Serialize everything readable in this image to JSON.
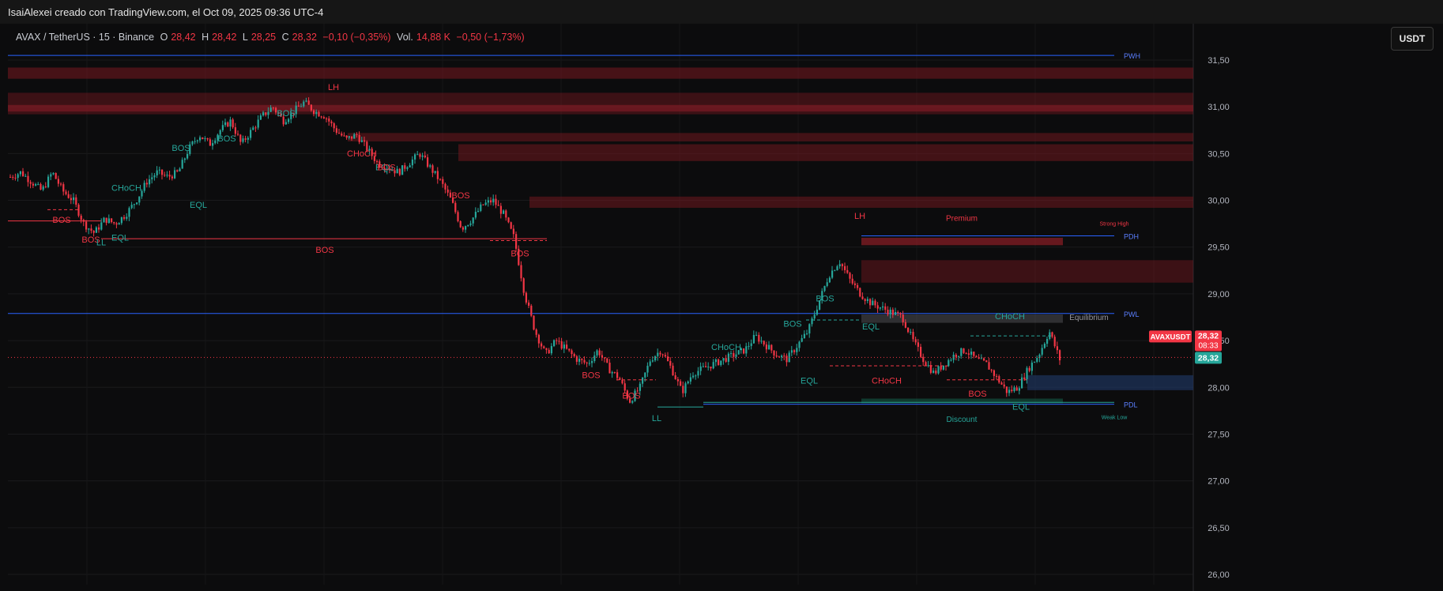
{
  "header": {
    "attribution": "IsaiAlexei creado con TradingView.com, el Oct 09, 2025 09:36 UTC-4"
  },
  "legend": {
    "symbol": "AVAX / TetherUS · 15 · Binance",
    "open_label": "O",
    "open": "28,42",
    "high_label": "H",
    "high": "28,42",
    "low_label": "L",
    "low": "28,25",
    "close_label": "C",
    "close": "28,32",
    "change": "−0,10 (−0,35%)",
    "vol_label": "Vol.",
    "vol": "14,88 K",
    "vol_change": "−0,50 (−1,73%)"
  },
  "currency_button": "USDT",
  "colors": {
    "up": "#26a69a",
    "down": "#f23645",
    "level": "#2962ff",
    "bg": "#0c0c0d"
  },
  "chart_data": {
    "type": "candlestick",
    "title": "",
    "ylim": [
      25.8,
      31.6
    ],
    "y_ticks": [
      "31,50",
      "31,00",
      "30,50",
      "30,00",
      "29,50",
      "29,00",
      "28,50",
      "28,00",
      "27,50",
      "27,00",
      "26,50",
      "26,00"
    ],
    "y_tick_values": [
      31.5,
      31.0,
      30.5,
      30.0,
      29.5,
      29.0,
      28.5,
      28.0,
      27.5,
      27.0,
      26.5,
      26.0
    ],
    "last_price": 28.32,
    "price_tags": {
      "symbol": "AVAXUSDT",
      "price": "28,32",
      "countdown": "08:33",
      "current": "28,32"
    },
    "levels": [
      {
        "label": "PWH",
        "value": 31.55
      },
      {
        "label": "PDH",
        "value": 29.62
      },
      {
        "label": "PWL",
        "value": 28.79
      },
      {
        "label": "PDL",
        "value": 27.82
      }
    ],
    "zones_text": {
      "premium": "Premium",
      "equilibrium": "Equilibrium",
      "discount": "Discount",
      "strong_high": "Strong High",
      "weak_low": "Weak Low"
    },
    "anchors": [
      30.25,
      30.3,
      30.2,
      30.1,
      30.3,
      30.1,
      30.0,
      29.75,
      29.65,
      29.8,
      29.75,
      29.85,
      30.0,
      30.2,
      30.3,
      30.25,
      30.3,
      30.55,
      30.7,
      30.6,
      30.75,
      30.85,
      30.6,
      30.75,
      30.9,
      31.0,
      30.85,
      30.95,
      31.05,
      30.95,
      30.9,
      30.75,
      30.65,
      30.7,
      30.55,
      30.4,
      30.35,
      30.3,
      30.4,
      30.5,
      30.35,
      30.2,
      30.0,
      29.7,
      29.8,
      29.95,
      30.0,
      29.85,
      29.6,
      29.0,
      28.6,
      28.35,
      28.5,
      28.4,
      28.3,
      28.25,
      28.4,
      28.2,
      28.1,
      27.85,
      28.0,
      28.3,
      28.4,
      28.2,
      27.95,
      28.15,
      28.2,
      28.25,
      28.3,
      28.35,
      28.4,
      28.55,
      28.45,
      28.35,
      28.3,
      28.45,
      28.6,
      28.9,
      29.2,
      29.35,
      29.15,
      29.0,
      28.9,
      28.85,
      28.8,
      28.75,
      28.5,
      28.3,
      28.15,
      28.25,
      28.35,
      28.4,
      28.3,
      28.25,
      28.1,
      27.95,
      28.0,
      28.2,
      28.35,
      28.6,
      28.3
    ]
  },
  "annotations": [
    {
      "t": "LH",
      "price": 31.18,
      "x": 422,
      "c": "down"
    },
    {
      "t": "BOS",
      "price": 30.9,
      "x": 362,
      "c": "up"
    },
    {
      "t": "BOS",
      "price": 30.63,
      "x": 287,
      "c": "up"
    },
    {
      "t": "BOS",
      "price": 30.53,
      "x": 229,
      "c": "up"
    },
    {
      "t": "CHoCH",
      "price": 30.47,
      "x": 458,
      "c": "down"
    },
    {
      "t": "EQL",
      "price": 30.32,
      "x": 486,
      "c": "up"
    },
    {
      "t": "BOS",
      "price": 30.32,
      "x": 489,
      "c": "down"
    },
    {
      "t": "CHoCH",
      "price": 30.1,
      "x": 160,
      "c": "up"
    },
    {
      "t": "EQL",
      "price": 29.92,
      "x": 251,
      "c": "up"
    },
    {
      "t": "BOS",
      "price": 30.02,
      "x": 583,
      "c": "down"
    },
    {
      "t": "BOS",
      "price": 29.76,
      "x": 78,
      "c": "down"
    },
    {
      "t": "BOS",
      "price": 29.55,
      "x": 115,
      "c": "down"
    },
    {
      "t": "LL",
      "price": 29.52,
      "x": 128,
      "c": "up"
    },
    {
      "t": "EQL",
      "price": 29.57,
      "x": 152,
      "c": "up"
    },
    {
      "t": "BOS",
      "price": 29.44,
      "x": 411,
      "c": "down"
    },
    {
      "t": "BOS",
      "price": 29.4,
      "x": 658,
      "c": "down"
    },
    {
      "t": "LH",
      "price": 29.8,
      "x": 1088,
      "c": "down"
    },
    {
      "t": "BOS",
      "price": 28.92,
      "x": 1044,
      "c": "up"
    },
    {
      "t": "EQL",
      "price": 28.62,
      "x": 1102,
      "c": "up"
    },
    {
      "t": "BOS",
      "price": 28.65,
      "x": 1003,
      "c": "up"
    },
    {
      "t": "CHoCH",
      "price": 28.73,
      "x": 1278,
      "c": "up"
    },
    {
      "t": "CHoCH",
      "price": 28.4,
      "x": 919,
      "c": "up"
    },
    {
      "t": "BOS",
      "price": 28.1,
      "x": 748,
      "c": "down"
    },
    {
      "t": "EQL",
      "price": 28.04,
      "x": 1024,
      "c": "up"
    },
    {
      "t": "CHoCH",
      "price": 28.04,
      "x": 1122,
      "c": "down"
    },
    {
      "t": "BOS",
      "price": 27.88,
      "x": 799,
      "c": "down"
    },
    {
      "t": "BOS",
      "price": 27.9,
      "x": 1237,
      "c": "down"
    },
    {
      "t": "EQL",
      "price": 27.76,
      "x": 1292,
      "c": "up"
    },
    {
      "t": "LL",
      "price": 27.64,
      "x": 831,
      "c": "up"
    }
  ]
}
